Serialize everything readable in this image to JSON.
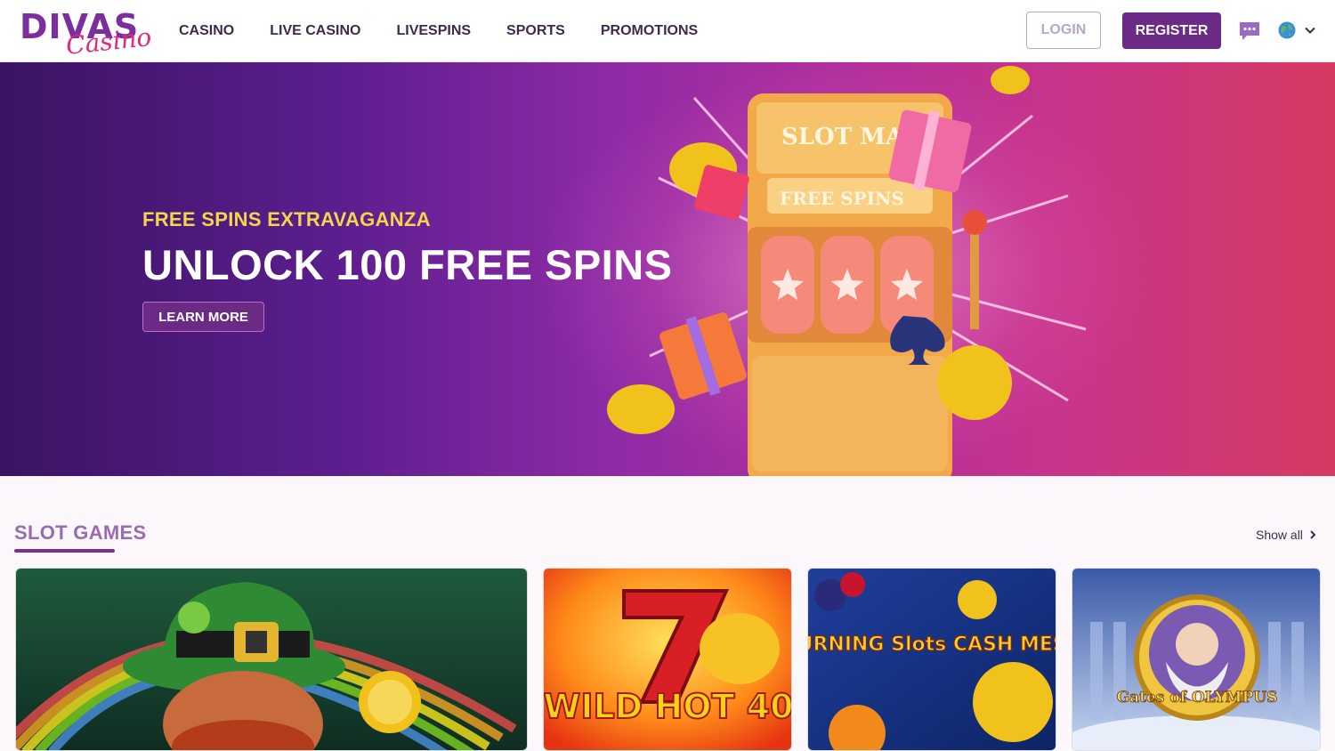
{
  "header": {
    "logo_top": "DIVAS",
    "logo_script": "Casino",
    "nav": [
      "CASINO",
      "LIVE CASINO",
      "LIVESPINS",
      "SPORTS",
      "PROMOTIONS"
    ],
    "login_label": "LOGIN",
    "register_label": "REGISTER"
  },
  "hero": {
    "subtitle": "FREE SPINS EXTRAVAGANZA",
    "title": "UNLOCK 100 FREE SPINS",
    "cta": "LEARN MORE",
    "machine_top": "SLOT MACH",
    "machine_sign": "FREE SPINS"
  },
  "slots": {
    "title": "SLOT GAMES",
    "show_all": "Show all",
    "games": [
      {
        "label": ""
      },
      {
        "label": "WILD HOT 40"
      },
      {
        "label": "BURNING Slots CASH MESH"
      },
      {
        "label": "Gates of OLYMPUS"
      }
    ]
  },
  "colors": {
    "brand_purple": "#6a2a86",
    "accent_yellow": "#f5d64a"
  }
}
